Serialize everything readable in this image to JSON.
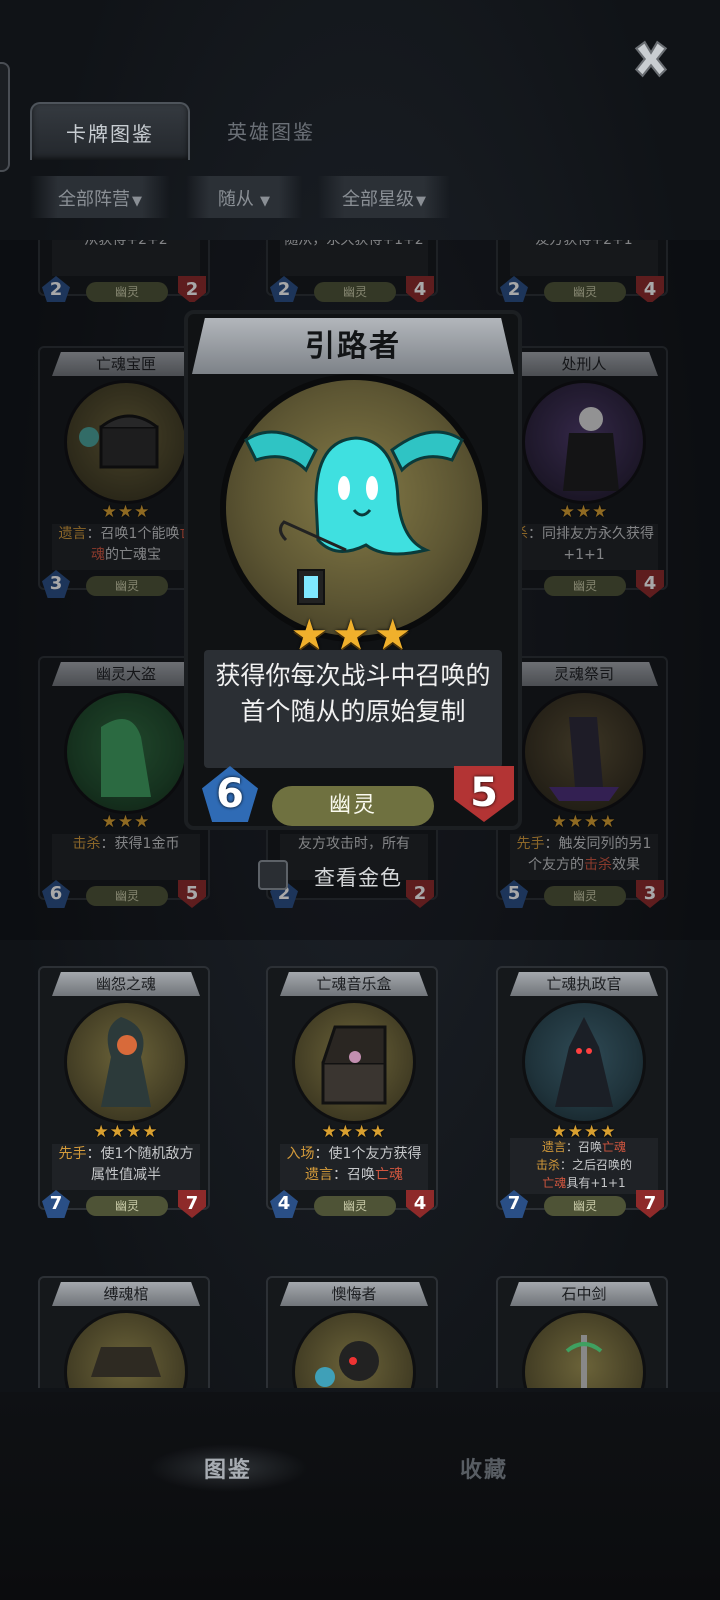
{
  "header": {
    "close_icon": "close-icon",
    "tabs": [
      {
        "label": "卡牌图鉴",
        "active": true
      },
      {
        "label": "英雄图鉴",
        "active": false
      }
    ]
  },
  "filters": [
    {
      "label": "全部阵营"
    },
    {
      "label": "随从"
    },
    {
      "label": "全部星级"
    }
  ],
  "top_partial_cards": [
    {
      "desc": "从获得+2+2",
      "atk": "2",
      "tribe": "幽灵",
      "hp": "2"
    },
    {
      "desc": "随从，永久获得+1+2",
      "atk": "2",
      "tribe": "幽灵",
      "hp": "4"
    },
    {
      "desc": "友方获得+2+1",
      "atk": "2",
      "tribe": "幽灵",
      "hp": "4"
    }
  ],
  "cards": {
    "c1": {
      "name": "亡魂宝匣",
      "stars": "★★★",
      "desc_kw": "遗言",
      "desc_a": "：召唤1个能唤",
      "desc_gh": "亡魂",
      "desc_b": "的亡魂宝",
      "atk": "3",
      "tribe": "幽灵",
      "hp": ""
    },
    "c3": {
      "name": "处刑人",
      "stars": "★★★",
      "desc_kw": "杀",
      "desc_a": "：同排友方永久获得+1+1",
      "atk": "",
      "tribe": "幽灵",
      "hp": "4"
    },
    "c4": {
      "name": "幽灵大盗",
      "stars": "★★★",
      "desc_kw": "击杀",
      "desc_a": "：获得1金币",
      "atk": "6",
      "tribe": "幽灵",
      "hp": "5"
    },
    "c5": {
      "desc": "友方攻击时，所有",
      "atk": "2",
      "hp": "2"
    },
    "c6": {
      "name": "灵魂祭司",
      "stars": "★★★★",
      "desc_kw": "先手",
      "desc_a": "：触发同列的另1个友方的",
      "desc_gh": "击杀",
      "desc_b": "效果",
      "atk": "5",
      "tribe": "幽灵",
      "hp": "3"
    },
    "c7": {
      "name": "幽怨之魂",
      "stars": "★★★★",
      "desc_kw": "先手",
      "desc_a": "：使1个随机敌方属性值减半",
      "atk": "7",
      "tribe": "幽灵",
      "hp": "7"
    },
    "c8": {
      "name": "亡魂音乐盒",
      "stars": "★★★★",
      "desc_kw": "入场",
      "desc_a": "：使1个友方获得",
      "desc_kw2": "遗言",
      "desc_b": "：召唤",
      "desc_gh": "亡魂",
      "atk": "4",
      "tribe": "幽灵",
      "hp": "4"
    },
    "c9": {
      "name": "亡魂执政官",
      "stars": "★★★★",
      "l1_kw": "遗言",
      "l1_a": "：召唤",
      "l1_gh": "亡魂",
      "l2_kw": "击杀",
      "l2_a": "：之后召唤的",
      "l3_gh": "亡魂",
      "l3_a": "具有+1+1",
      "atk": "7",
      "tribe": "幽灵",
      "hp": "7"
    },
    "c10": {
      "name": "缚魂棺"
    },
    "c11": {
      "name": "懊悔者"
    },
    "c12": {
      "name": "石中剑"
    }
  },
  "featured": {
    "name": "引路者",
    "stars": "★★★",
    "desc": "获得你每次战斗中召唤的首个随从的原始复制",
    "atk": "6",
    "tribe": "幽灵",
    "hp": "5",
    "art_icon": "ghost-bat-lantern-icon"
  },
  "gold_toggle": {
    "label": "查看金色",
    "checked": false
  },
  "bottom_nav": [
    {
      "label": "图鉴",
      "active": true
    },
    {
      "label": "收藏",
      "active": false
    }
  ],
  "colors": {
    "background": "#121519",
    "star": "#f0b02c",
    "keyword": "#d39a3a",
    "ghost_keyword": "#d2563f",
    "attack_badge": "#2f6bb5",
    "health_badge": "#b33434",
    "tribe_pill": "#6f7140"
  }
}
